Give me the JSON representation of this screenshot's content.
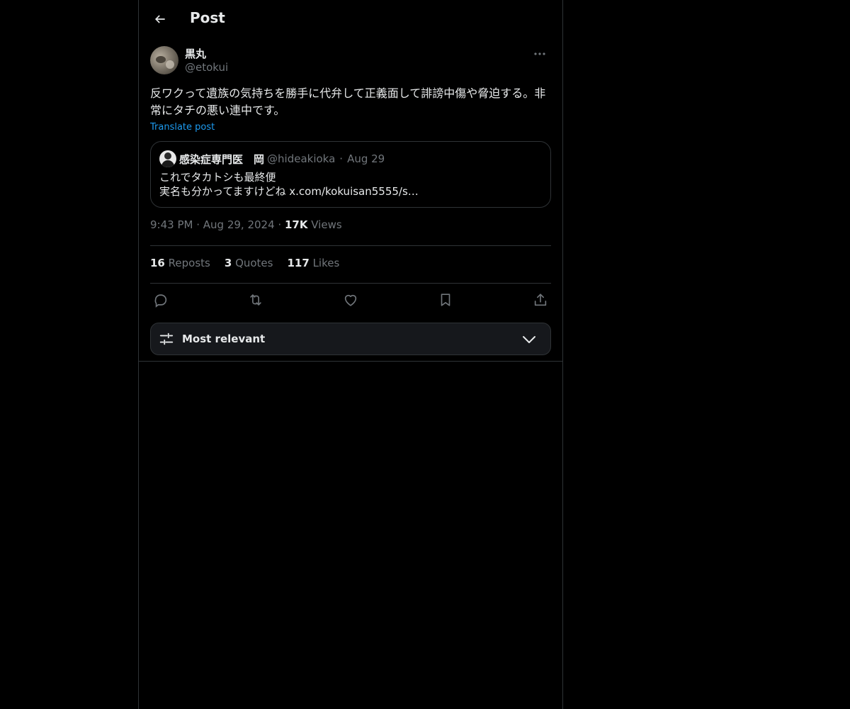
{
  "header": {
    "title": "Post"
  },
  "post": {
    "author_name": "黒丸",
    "author_handle": "@etokui",
    "text": "反ワクって遺族の気持ちを勝手に代弁して正義面して誹謗中傷や脅迫する。非常にタチの悪い連中です。",
    "translate_label": "Translate post",
    "time": "9:43 PM",
    "date": "Aug 29, 2024",
    "views_count": "17K",
    "views_label": "Views"
  },
  "quote": {
    "name": "感染症専門医　岡",
    "handle": "@hideakioka",
    "date": "Aug 29",
    "line1": "これでタカトシも最終便",
    "line2": "実名も分かってますけどね x.com/kokuisan5555/s…"
  },
  "stats": {
    "reposts_count": "16",
    "reposts_label": "Reposts",
    "quotes_count": "3",
    "quotes_label": "Quotes",
    "likes_count": "117",
    "likes_label": "Likes"
  },
  "actions": [
    "reply-icon",
    "repost-icon",
    "like-icon",
    "bookmark-icon",
    "share-icon"
  ],
  "sort": {
    "label": "Most relevant"
  },
  "colors": {
    "background": "#000000",
    "text": "#e7e9ea",
    "muted": "#71767b",
    "link": "#1d9bf0",
    "border": "#2f3336"
  }
}
